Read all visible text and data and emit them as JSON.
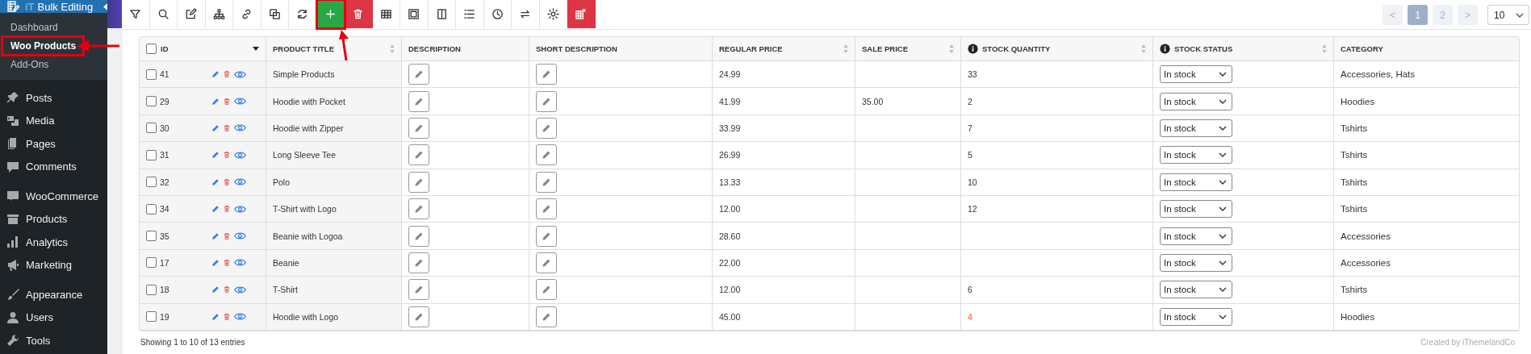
{
  "sidebar": {
    "plugin": {
      "brand": "iT",
      "title": "Bulk Editing"
    },
    "submenu": [
      {
        "label": "Dashboard",
        "selected": false,
        "highlighted": false
      },
      {
        "label": "Woo Products",
        "selected": true,
        "highlighted": true
      },
      {
        "label": "Add-Ons",
        "selected": false,
        "highlighted": false
      }
    ],
    "menu_groups": [
      [
        "Posts",
        "Media",
        "Pages",
        "Comments"
      ],
      [
        "WooCommerce",
        "Products",
        "Analytics",
        "Marketing"
      ],
      [
        "Appearance",
        "Users",
        "Tools"
      ]
    ]
  },
  "toolbar": {
    "buttons": [
      {
        "kind": "plain",
        "highlighted": false
      },
      {
        "kind": "plain",
        "highlighted": false
      },
      {
        "kind": "plain",
        "highlighted": false
      },
      {
        "kind": "plain",
        "highlighted": false
      },
      {
        "kind": "plain",
        "highlighted": false
      },
      {
        "kind": "plain",
        "highlighted": false
      },
      {
        "kind": "plain",
        "highlighted": false
      },
      {
        "kind": "add",
        "highlighted": true
      },
      {
        "kind": "danger",
        "highlighted": false
      },
      {
        "kind": "plain",
        "highlighted": false
      },
      {
        "kind": "plain",
        "highlighted": false
      },
      {
        "kind": "plain",
        "highlighted": false
      },
      {
        "kind": "plain",
        "highlighted": false
      },
      {
        "kind": "plain",
        "highlighted": false
      },
      {
        "kind": "plain",
        "highlighted": false
      },
      {
        "kind": "plain",
        "highlighted": false
      },
      {
        "kind": "danger",
        "highlighted": false
      }
    ]
  },
  "pagination": {
    "previous": "<",
    "pages": [
      {
        "label": "1",
        "selected": true
      },
      {
        "label": "2",
        "selected": false
      }
    ],
    "next": ">",
    "per_page": "10"
  },
  "table": {
    "select_all": {
      "checked": false
    },
    "columns": [
      {
        "label": "ID",
        "sortable": false,
        "info": false,
        "menu": true
      },
      {
        "label": "PRODUCT TITLE",
        "sortable": true,
        "info": false,
        "menu": false
      },
      {
        "label": "DESCRIPTION",
        "sortable": false,
        "info": false,
        "menu": false
      },
      {
        "label": "SHORT DESCRIPTION",
        "sortable": false,
        "info": false,
        "menu": false
      },
      {
        "label": "REGULAR PRICE",
        "sortable": true,
        "info": false,
        "menu": false
      },
      {
        "label": "SALE PRICE",
        "sortable": true,
        "info": false,
        "menu": false
      },
      {
        "label": "STOCK QUANTITY",
        "sortable": true,
        "info": true,
        "menu": false
      },
      {
        "label": "STOCK STATUS",
        "sortable": true,
        "info": true,
        "menu": false
      },
      {
        "label": "CATEGORY",
        "sortable": false,
        "info": false,
        "menu": false
      }
    ],
    "rows": [
      {
        "checked": false,
        "id": "41",
        "title": "Simple Products",
        "regular_price": "24.99",
        "sale_price": "",
        "stock_quantity": "33",
        "quantity_low": false,
        "stock_status": "In stock",
        "category": "Accessories, Hats"
      },
      {
        "checked": false,
        "id": "29",
        "title": "Hoodie with Pocket",
        "regular_price": "41.99",
        "sale_price": "35.00",
        "stock_quantity": "2",
        "quantity_low": false,
        "stock_status": "In stock",
        "category": "Hoodies"
      },
      {
        "checked": false,
        "id": "30",
        "title": "Hoodie with Zipper",
        "regular_price": "33.99",
        "sale_price": "",
        "stock_quantity": "7",
        "quantity_low": false,
        "stock_status": "In stock",
        "category": "Tshirts"
      },
      {
        "checked": false,
        "id": "31",
        "title": "Long Sleeve Tee",
        "regular_price": "26.99",
        "sale_price": "",
        "stock_quantity": "5",
        "quantity_low": false,
        "stock_status": "In stock",
        "category": "Tshirts"
      },
      {
        "checked": false,
        "id": "32",
        "title": "Polo",
        "regular_price": "13.33",
        "sale_price": "",
        "stock_quantity": "10",
        "quantity_low": false,
        "stock_status": "In stock",
        "category": "Tshirts"
      },
      {
        "checked": false,
        "id": "34",
        "title": "T-Shirt with Logo",
        "regular_price": "12.00",
        "sale_price": "",
        "stock_quantity": "12",
        "quantity_low": false,
        "stock_status": "In stock",
        "category": "Tshirts"
      },
      {
        "checked": false,
        "id": "35",
        "title": "Beanie with Logoa",
        "regular_price": "28.60",
        "sale_price": "",
        "stock_quantity": "",
        "stock_status": "In stock",
        "category": "Accessories"
      },
      {
        "checked": false,
        "id": "17",
        "title": "Beanie",
        "regular_price": "22.00",
        "sale_price": "",
        "stock_quantity": "",
        "stock_status": "In stock",
        "category": "Accessories"
      },
      {
        "checked": false,
        "id": "18",
        "title": "T-Shirt",
        "regular_price": "12.00",
        "sale_price": "",
        "stock_quantity": "6",
        "quantity_low": false,
        "stock_status": "In stock",
        "category": "Tshirts"
      },
      {
        "checked": false,
        "id": "19",
        "title": "Hoodie with Logo",
        "regular_price": "45.00",
        "sale_price": "",
        "stock_quantity": "4",
        "quantity_low": true,
        "stock_status": "In stock",
        "category": "Hoodies"
      }
    ]
  },
  "footer": {
    "summary": "Showing 1 to 10 of 13 entries",
    "credit": "Created by iThemelandCo"
  }
}
